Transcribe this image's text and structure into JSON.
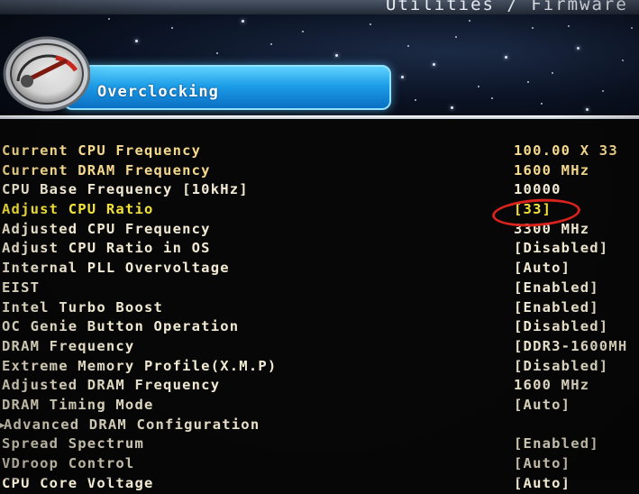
{
  "header": {
    "top_strip_text": "Utilities / Firmware",
    "section_title": "Overclocking",
    "icon": "speedometer-gauge-icon"
  },
  "colors": {
    "info_text": "#f5d98c",
    "setting_text": "#f2ead2",
    "selected_text": "#f3e23a",
    "section_bar": "#1e9ee8",
    "annotation_circle": "#d8231d"
  },
  "settings": [
    {
      "label": "Current CPU Frequency",
      "value": "100.00 X 33",
      "kind": "info"
    },
    {
      "label": "Current DRAM Frequency",
      "value": "1600 MHz",
      "kind": "info"
    },
    {
      "label": "CPU Base Frequency [10kHz]",
      "value": "10000",
      "kind": "setting"
    },
    {
      "label": "Adjust CPU Ratio",
      "value": "[33]",
      "kind": "selected"
    },
    {
      "label": "Adjusted CPU Frequency",
      "value": "3300 MHz",
      "kind": "setting"
    },
    {
      "label": "Adjust CPU Ratio in OS",
      "value": "[Disabled]",
      "kind": "setting"
    },
    {
      "label": "Internal PLL Overvoltage",
      "value": "[Auto]",
      "kind": "setting"
    },
    {
      "label": "EIST",
      "value": "[Enabled]",
      "kind": "setting"
    },
    {
      "label": "Intel Turbo Boost",
      "value": "[Enabled]",
      "kind": "setting"
    },
    {
      "label": "OC Genie Button Operation",
      "value": "[Disabled]",
      "kind": "setting"
    },
    {
      "label": "DRAM Frequency",
      "value": "[DDR3-1600MH",
      "kind": "setting"
    },
    {
      "label": "Extreme Memory Profile(X.M.P)",
      "value": "[Disabled]",
      "kind": "setting"
    },
    {
      "label": "Adjusted DRAM Frequency",
      "value": "1600 MHz",
      "kind": "setting"
    },
    {
      "label": "DRAM Timing Mode",
      "value": "[Auto]",
      "kind": "setting"
    },
    {
      "label": "Advanced DRAM Configuration",
      "value": "",
      "kind": "submenu",
      "arrow": "▸"
    },
    {
      "label": "Spread Spectrum",
      "value": "[Enabled]",
      "kind": "setting"
    },
    {
      "label": "VDroop Control",
      "value": "[Auto]",
      "kind": "setting"
    },
    {
      "label": "CPU Core Voltage",
      "value": "[Auto]",
      "kind": "setting"
    }
  ]
}
